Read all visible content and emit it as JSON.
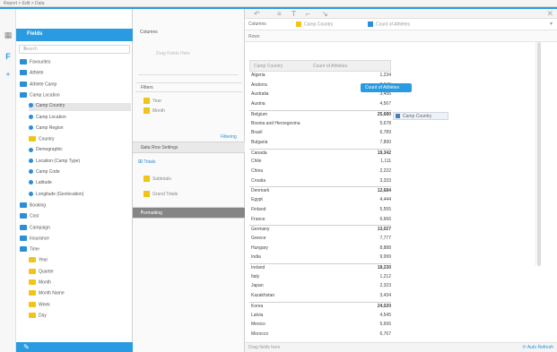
{
  "topbar": {
    "breadcrumb": "Report > Edit > Data"
  },
  "colors": {
    "accent": "#2a9be0",
    "folder_blue": "#2a8fd6",
    "folder_yellow": "#f0c419"
  },
  "rail": {
    "icons": [
      "grid-icon",
      "filter-icon",
      "add-icon"
    ]
  },
  "fields": {
    "title": "Fields",
    "search_placeholder": "Search",
    "tree": [
      {
        "label": "Favourites",
        "type": "folder",
        "color": "blue",
        "indent": 0
      },
      {
        "label": "Athlete",
        "type": "folder",
        "color": "blue",
        "indent": 0
      },
      {
        "label": "Athlete Camp",
        "type": "folder",
        "color": "blue",
        "indent": 0
      },
      {
        "label": "Camp Location",
        "type": "folder",
        "color": "blue",
        "indent": 0
      },
      {
        "label": "Camp Country",
        "type": "dot",
        "indent": 1,
        "selected": true
      },
      {
        "label": "Camp Location",
        "type": "dot",
        "indent": 1
      },
      {
        "label": "Camp Region",
        "type": "dot",
        "indent": 1
      },
      {
        "label": "Country",
        "type": "folder",
        "color": "yellow",
        "indent": 1
      },
      {
        "label": "Demographic",
        "type": "dot",
        "indent": 1
      },
      {
        "label": "Location (Camp Type)",
        "type": "dot",
        "indent": 1
      },
      {
        "label": "Camp Code",
        "type": "dot",
        "indent": 1
      },
      {
        "label": "Latitude",
        "type": "dot",
        "indent": 1
      },
      {
        "label": "Longitude (Geolocation)",
        "type": "dot",
        "indent": 1
      },
      {
        "label": "Booking",
        "type": "folder",
        "color": "blue",
        "indent": 0
      },
      {
        "label": "Cost",
        "type": "folder",
        "color": "blue",
        "indent": 0
      },
      {
        "label": "Campaign",
        "type": "folder",
        "color": "blue",
        "indent": 0
      },
      {
        "label": "Insurance",
        "type": "folder",
        "color": "blue",
        "indent": 0
      },
      {
        "label": "Time",
        "type": "folder",
        "color": "blue",
        "indent": 0
      },
      {
        "label": "Year",
        "type": "folder",
        "color": "yellow",
        "indent": 1
      },
      {
        "label": "Quarter",
        "type": "folder",
        "color": "yellow",
        "indent": 1
      },
      {
        "label": "Month",
        "type": "folder",
        "color": "yellow",
        "indent": 1
      },
      {
        "label": "Month Name",
        "type": "folder",
        "color": "yellow",
        "indent": 1
      },
      {
        "label": "Week",
        "type": "folder",
        "color": "yellow",
        "indent": 1
      },
      {
        "label": "Day",
        "type": "folder",
        "color": "yellow",
        "indent": 1
      }
    ],
    "bottom_icon": "pencil-icon"
  },
  "properties": {
    "title": "Columns",
    "drop_hint": "Drag Fields Here",
    "filters_title": "Filters",
    "filter_chips": [
      "Year",
      "Month"
    ],
    "link": "Filtering",
    "section_settings": "Data Row Settings",
    "ts_label": "Totals",
    "option_chips": [
      "Subtotals",
      "Grand Totals"
    ],
    "section_dark": "Formatting"
  },
  "toolbar": {
    "icons": [
      "undo-icon",
      "align-icon",
      "text-icon",
      "format-icon",
      "arrow-icon"
    ]
  },
  "columns": {
    "label": "Columns",
    "pills": [
      {
        "label": "Camp Country",
        "color": "#f0c419"
      },
      {
        "label": "Count of Athletes",
        "color": "#2a8fd6"
      }
    ]
  },
  "rows": {
    "label": "Rows"
  },
  "report": {
    "header_left": "Camp Country",
    "header_right": "Count of Athletes",
    "rows": [
      {
        "label": "Algeria",
        "value": "1,234"
      },
      {
        "label": "Andorra",
        "value": "2,345"
      },
      {
        "label": "Australia",
        "value": "3,456"
      },
      {
        "label": "Austria",
        "value": "4,567"
      },
      {
        "label": "Belgium",
        "value": "25,680",
        "group": true,
        "bold": true
      },
      {
        "label": "Bosnia and Herzegovina",
        "value": "5,678"
      },
      {
        "label": "Brazil",
        "value": "6,789"
      },
      {
        "label": "Bulgaria",
        "value": "7,890"
      },
      {
        "label": "Canada",
        "value": "19,342",
        "group": true,
        "bold": true
      },
      {
        "label": "Chile",
        "value": "1,111"
      },
      {
        "label": "China",
        "value": "2,222"
      },
      {
        "label": "Croatia",
        "value": "3,333"
      },
      {
        "label": "Denmark",
        "value": "12,684",
        "group": true,
        "bold": true
      },
      {
        "label": "Egypt",
        "value": "4,444"
      },
      {
        "label": "Finland",
        "value": "5,555"
      },
      {
        "label": "France",
        "value": "6,666"
      },
      {
        "label": "Germany",
        "value": "13,027",
        "group": true,
        "bold": true
      },
      {
        "label": "Greece",
        "value": "7,777"
      },
      {
        "label": "Hungary",
        "value": "8,888"
      },
      {
        "label": "India",
        "value": "9,999"
      },
      {
        "label": "Ireland",
        "value": "18,230",
        "group": true,
        "bold": true
      },
      {
        "label": "Italy",
        "value": "1,212"
      },
      {
        "label": "Japan",
        "value": "2,323"
      },
      {
        "label": "Kazakhstan",
        "value": "3,434"
      },
      {
        "label": "Korea",
        "value": "24,020",
        "group": true,
        "bold": true
      },
      {
        "label": "Latvia",
        "value": "4,545"
      },
      {
        "label": "Mexico",
        "value": "5,656"
      },
      {
        "label": "Morocco",
        "value": "6,767"
      }
    ]
  },
  "callout": "Count of Athletes",
  "tag": "Camp Country",
  "footer": {
    "left": "Drag fields here",
    "right": "Auto Refresh"
  }
}
